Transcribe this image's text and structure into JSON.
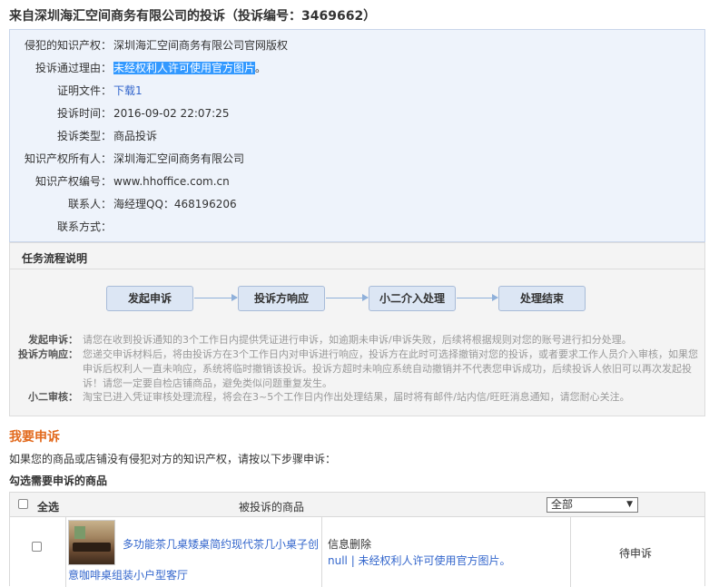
{
  "header": {
    "title": "来自深圳海汇空间商务有限公司的投诉（投诉编号：3469662）"
  },
  "info": {
    "rows": [
      {
        "label": "侵犯的知识产权：",
        "value": "深圳海汇空间商务有限公司官网版权"
      },
      {
        "label": "投诉通过理由：",
        "value": "未经权利人许可使用官方图片",
        "suffix": "。"
      },
      {
        "label": "证明文件：",
        "value": "下载1"
      },
      {
        "label": "投诉时间：",
        "value": "2016-09-02 22:07:25"
      },
      {
        "label": "投诉类型：",
        "value": "商品投诉"
      },
      {
        "label": "知识产权所有人：",
        "value": "深圳海汇空间商务有限公司"
      },
      {
        "label": "知识产权编号：",
        "value": "www.hhoffice.com.cn"
      },
      {
        "label": "联系人：",
        "value": "海经理QQ：468196206"
      },
      {
        "label": "联系方式：",
        "value": ""
      }
    ]
  },
  "flow": {
    "title": "任务流程说明",
    "steps": [
      "发起申诉",
      "投诉方响应",
      "小二介入处理",
      "处理结束"
    ],
    "descriptions": [
      {
        "label": "发起申诉：",
        "text": "请您在收到投诉通知的3个工作日内提供凭证进行申诉，如逾期未申诉/申诉失败，后续将根据规则对您的账号进行扣分处理。"
      },
      {
        "label": "投诉方响应：",
        "text": "您递交申诉材料后，将由投诉方在3个工作日内对申诉进行响应，投诉方在此时可选择撤销对您的投诉，或者要求工作人员介入审核，如果您申诉后权利人一直未响应，系统将临时撤销该投诉。投诉方超时未响应系统自动撤销并不代表您申诉成功，后续投诉人依旧可以再次发起投诉！请您一定要自检店铺商品，避免类似问题重复发生。"
      },
      {
        "label": "小二审核：",
        "text": "淘宝已进入凭证审核处理流程，将会在3~5个工作日内作出处理结果，届时将有邮件/站内信/旺旺消息通知，请您耐心关注。"
      }
    ]
  },
  "appeal": {
    "title": "我要申诉",
    "intro": "如果您的商品或店铺没有侵犯对方的知识产权，请按以下步骤申诉：",
    "subtitle": "勾选需要申诉的商品"
  },
  "table": {
    "select_all": "全选",
    "col_product": "被投诉的商品",
    "filter_value": "全部",
    "rows": [
      {
        "product_line1": "多功能茶几桌矮桌简约现代茶几小桌子创",
        "product_line2": "意咖啡桌组装小户型客厅",
        "reason_title": "信息删除",
        "reason_detail": "null | 未经权利人许可使用官方图片。",
        "status": "待申诉"
      }
    ]
  }
}
